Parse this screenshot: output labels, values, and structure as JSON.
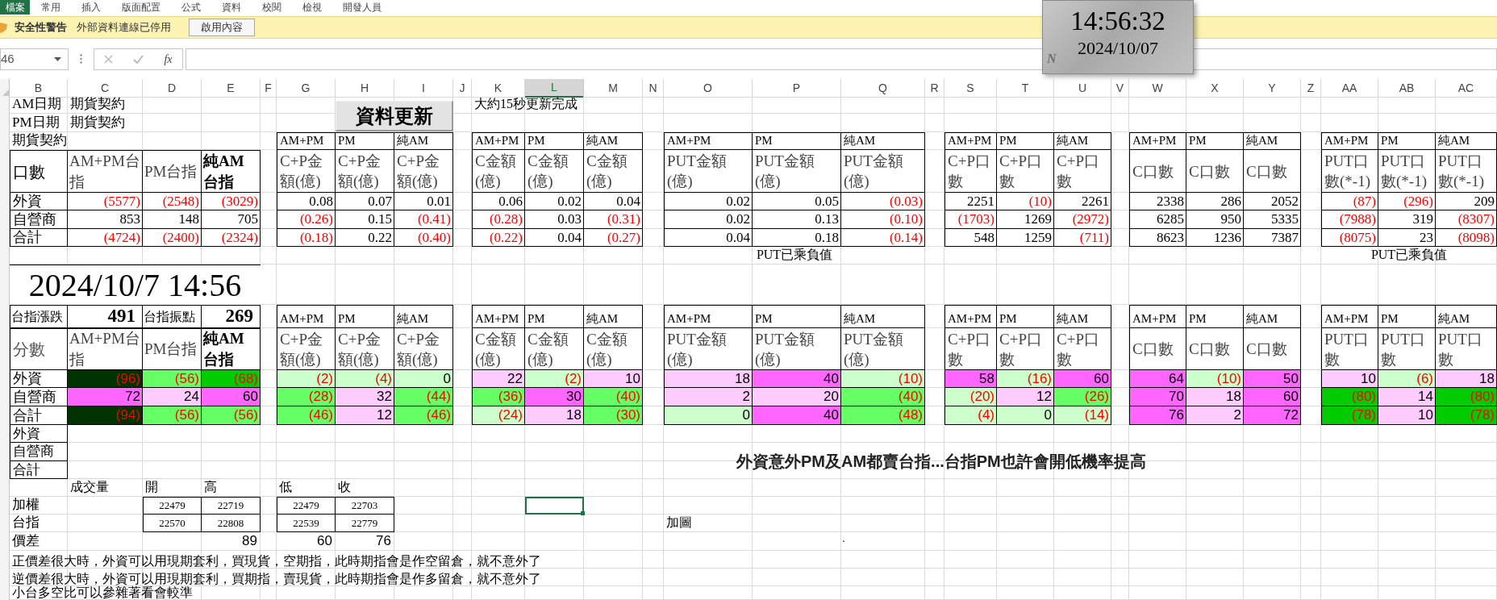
{
  "ribbon": {
    "file_tab": "檔案",
    "tabs": [
      "常用",
      "插入",
      "版面配置",
      "公式",
      "資料",
      "校閱",
      "檢視",
      "開發人員"
    ]
  },
  "security_bar": {
    "title": "安全性警告",
    "message": "外部資料連線已停用",
    "button": "啟用內容"
  },
  "formula_bar": {
    "name_box": "46",
    "function_button": "fx"
  },
  "clock": {
    "time": "14:56:32",
    "date": "2024/10/07",
    "badge": "N"
  },
  "columns": [
    {
      "label": "B",
      "selected": false
    },
    {
      "label": "C",
      "selected": false
    },
    {
      "label": "D",
      "selected": false
    },
    {
      "label": "E",
      "selected": false
    },
    {
      "label": "F",
      "selected": false
    },
    {
      "label": "G",
      "selected": false
    },
    {
      "label": "H",
      "selected": false
    },
    {
      "label": "I",
      "selected": false
    },
    {
      "label": "J",
      "selected": false
    },
    {
      "label": "K",
      "selected": false
    },
    {
      "label": "L",
      "selected": true
    },
    {
      "label": "M",
      "selected": false
    },
    {
      "label": "N",
      "selected": false
    },
    {
      "label": "O",
      "selected": false
    },
    {
      "label": "P",
      "selected": false
    },
    {
      "label": "Q",
      "selected": false
    },
    {
      "label": "R",
      "selected": false
    },
    {
      "label": "S",
      "selected": false
    },
    {
      "label": "T",
      "selected": false
    },
    {
      "label": "U",
      "selected": false
    },
    {
      "label": "V",
      "selected": false
    },
    {
      "label": "W",
      "selected": false
    },
    {
      "label": "X",
      "selected": false
    },
    {
      "label": "Y",
      "selected": false
    },
    {
      "label": "Z",
      "selected": false
    },
    {
      "label": "AA",
      "selected": false
    },
    {
      "label": "AB",
      "selected": false
    },
    {
      "label": "AC",
      "selected": false
    }
  ],
  "sheet": {
    "info_rows": [
      [
        "AM日期",
        "期貨契約"
      ],
      [
        "PM日期",
        "期貨契約"
      ]
    ],
    "refresh_button": "資料更新",
    "refresh_note": "大約15秒更新完成",
    "upper": {
      "caption": "期貨契約",
      "summary": {
        "corner": "口數",
        "headers": [
          {
            "text": "AM+PM台指",
            "bold": false
          },
          {
            "text": "PM台指",
            "bold": false
          },
          {
            "text": "純AM台指",
            "bold": true
          }
        ],
        "rows": [
          {
            "label": "外資",
            "cells": [
              {
                "value": "(5577)",
                "negative": true
              },
              {
                "value": "(2548)",
                "negative": true
              },
              {
                "value": "(3029)",
                "negative": true
              }
            ]
          },
          {
            "label": "自營商",
            "cells": [
              {
                "value": "853",
                "negative": false
              },
              {
                "value": "148",
                "negative": false
              },
              {
                "value": "705",
                "negative": false
              }
            ]
          },
          {
            "label": "合計",
            "cells": [
              {
                "value": "(4724)",
                "negative": true
              },
              {
                "value": "(2400)",
                "negative": true
              },
              {
                "value": "(2324)",
                "negative": true
              }
            ]
          }
        ]
      },
      "groups": [
        {
          "periods": [
            "AM+PM",
            "PM",
            "純AM"
          ],
          "headers": [
            "C+P金額(億)",
            "C+P金額(億)",
            "C+P金額(億)"
          ],
          "rows": [
            [
              {
                "value": "0.08",
                "negative": false
              },
              {
                "value": "0.07",
                "negative": false
              },
              {
                "value": "0.01",
                "negative": false
              }
            ],
            [
              {
                "value": "(0.26)",
                "negative": true
              },
              {
                "value": "0.15",
                "negative": false
              },
              {
                "value": "(0.41)",
                "negative": true
              }
            ],
            [
              {
                "value": "(0.18)",
                "negative": true
              },
              {
                "value": "0.22",
                "negative": false
              },
              {
                "value": "(0.40)",
                "negative": true
              }
            ]
          ]
        },
        {
          "periods": [
            "AM+PM",
            "PM",
            "純AM"
          ],
          "headers": [
            "C金額(億)",
            "C金額(億)",
            "C金額(億)"
          ],
          "rows": [
            [
              {
                "value": "0.06",
                "negative": false
              },
              {
                "value": "0.02",
                "negative": false
              },
              {
                "value": "0.04",
                "negative": false
              }
            ],
            [
              {
                "value": "(0.28)",
                "negative": true
              },
              {
                "value": "0.03",
                "negative": false
              },
              {
                "value": "(0.31)",
                "negative": true
              }
            ],
            [
              {
                "value": "(0.22)",
                "negative": true
              },
              {
                "value": "0.04",
                "negative": false
              },
              {
                "value": "(0.27)",
                "negative": true
              }
            ]
          ]
        },
        {
          "periods": [
            "AM+PM",
            "PM",
            "純AM"
          ],
          "headers": [
            "PUT金額(億)",
            "PUT金額(億)",
            "PUT金額(億)"
          ],
          "rows": [
            [
              {
                "value": "0.02",
                "negative": false
              },
              {
                "value": "0.05",
                "negative": false
              },
              {
                "value": "(0.03)",
                "negative": true
              }
            ],
            [
              {
                "value": "0.02",
                "negative": false
              },
              {
                "value": "0.13",
                "negative": false
              },
              {
                "value": "(0.10)",
                "negative": true
              }
            ],
            [
              {
                "value": "0.04",
                "negative": false
              },
              {
                "value": "0.18",
                "negative": false
              },
              {
                "value": "(0.14)",
                "negative": true
              }
            ]
          ],
          "note": "PUT已乘負值"
        },
        {
          "periods": [
            "AM+PM",
            "PM",
            "純AM"
          ],
          "headers": [
            "C+P口數",
            "C+P口數",
            "C+P口數"
          ],
          "rows": [
            [
              {
                "value": "2251",
                "negative": false
              },
              {
                "value": "(10)",
                "negative": true
              },
              {
                "value": "2261",
                "negative": false
              }
            ],
            [
              {
                "value": "(1703)",
                "negative": true
              },
              {
                "value": "1269",
                "negative": false
              },
              {
                "value": "(2972)",
                "negative": true
              }
            ],
            [
              {
                "value": "548",
                "negative": false
              },
              {
                "value": "1259",
                "negative": false
              },
              {
                "value": "(711)",
                "negative": true
              }
            ]
          ]
        },
        {
          "periods": [
            "AM+PM",
            "PM",
            "純AM"
          ],
          "headers": [
            "C口數",
            "C口數",
            "C口數"
          ],
          "rows": [
            [
              {
                "value": "2338",
                "negative": false
              },
              {
                "value": "286",
                "negative": false
              },
              {
                "value": "2052",
                "negative": false
              }
            ],
            [
              {
                "value": "6285",
                "negative": false
              },
              {
                "value": "950",
                "negative": false
              },
              {
                "value": "5335",
                "negative": false
              }
            ],
            [
              {
                "value": "8623",
                "negative": false
              },
              {
                "value": "1236",
                "negative": false
              },
              {
                "value": "7387",
                "negative": false
              }
            ]
          ]
        },
        {
          "periods": [
            "AM+PM",
            "PM",
            "純AM"
          ],
          "headers": [
            "PUT口數(*-1)",
            "PUT口數(*-1)",
            "PUT口數(*-1)"
          ],
          "rows": [
            [
              {
                "value": "(87)",
                "negative": true
              },
              {
                "value": "(296)",
                "negative": true
              },
              {
                "value": "209",
                "negative": false
              }
            ],
            [
              {
                "value": "(7988)",
                "negative": true
              },
              {
                "value": "319",
                "negative": false
              },
              {
                "value": "(8307)",
                "negative": true
              }
            ],
            [
              {
                "value": "(8075)",
                "negative": true
              },
              {
                "value": "23",
                "negative": false
              },
              {
                "value": "(8098)",
                "negative": true
              }
            ]
          ],
          "note": "PUT已乘負值"
        }
      ]
    },
    "timestamp": "2024/10/7 14:56",
    "lower": {
      "stats": [
        {
          "label": "台指漲跌",
          "value": "491"
        },
        {
          "label": "台指振點",
          "value": "269"
        }
      ],
      "summary": {
        "corner": "分數",
        "headers": [
          {
            "text": "AM+PM台指",
            "bold": false
          },
          {
            "text": "PM台指",
            "bold": false
          },
          {
            "text": "純AM台指",
            "bold": true
          }
        ],
        "rows": [
          {
            "label": "外資",
            "cells": [
              {
                "value": "(96)",
                "negative": true,
                "color": "#003300"
              },
              {
                "value": "(56)",
                "negative": true,
                "color": "#66ff66"
              },
              {
                "value": "(68)",
                "negative": true,
                "color": "#00cc00"
              }
            ]
          },
          {
            "label": "自營商",
            "cells": [
              {
                "value": "72",
                "negative": false,
                "color": "#ff66ff"
              },
              {
                "value": "24",
                "negative": false,
                "color": "#ffccff"
              },
              {
                "value": "60",
                "negative": false,
                "color": "#ff66ff"
              }
            ]
          },
          {
            "label": "合計",
            "cells": [
              {
                "value": "(94)",
                "negative": true,
                "color": "#003300"
              },
              {
                "value": "(56)",
                "negative": true,
                "color": "#66ff66"
              },
              {
                "value": "(56)",
                "negative": true,
                "color": "#66ff66"
              }
            ]
          }
        ]
      },
      "groups": [
        {
          "periods": [
            "AM+PM",
            "PM",
            "純AM"
          ],
          "headers": [
            "C+P金額(億)",
            "C+P金額(億)",
            "C+P金額(億)"
          ],
          "rows": [
            [
              {
                "value": "(2)",
                "negative": true,
                "color": "#ccffcc"
              },
              {
                "value": "(4)",
                "negative": true,
                "color": "#ccffcc"
              },
              {
                "value": "0",
                "negative": false,
                "color": "#ccffcc"
              }
            ],
            [
              {
                "value": "(28)",
                "negative": true,
                "color": "#66ff66"
              },
              {
                "value": "32",
                "negative": false,
                "color": "#ffccff"
              },
              {
                "value": "(44)",
                "negative": true,
                "color": "#66ff66"
              }
            ],
            [
              {
                "value": "(46)",
                "negative": true,
                "color": "#66ff66"
              },
              {
                "value": "12",
                "negative": false,
                "color": "#ffccff"
              },
              {
                "value": "(46)",
                "negative": true,
                "color": "#66ff66"
              }
            ]
          ]
        },
        {
          "periods": [
            "AM+PM",
            "PM",
            "純AM"
          ],
          "headers": [
            "C金額(億)",
            "C金額(億)",
            "C金額(億)"
          ],
          "rows": [
            [
              {
                "value": "22",
                "negative": false,
                "color": "#ffccff"
              },
              {
                "value": "(2)",
                "negative": true,
                "color": "#ccffcc"
              },
              {
                "value": "10",
                "negative": false,
                "color": "#ffccff"
              }
            ],
            [
              {
                "value": "(36)",
                "negative": true,
                "color": "#66ff66"
              },
              {
                "value": "30",
                "negative": false,
                "color": "#ff66ff"
              },
              {
                "value": "(40)",
                "negative": true,
                "color": "#66ff66"
              }
            ],
            [
              {
                "value": "(24)",
                "negative": true,
                "color": "#ccffcc"
              },
              {
                "value": "18",
                "negative": false,
                "color": "#ffccff"
              },
              {
                "value": "(30)",
                "negative": true,
                "color": "#66ff66"
              }
            ]
          ]
        },
        {
          "periods": [
            "AM+PM",
            "PM",
            "純AM"
          ],
          "headers": [
            "PUT金額(億)",
            "PUT金額(億)",
            "PUT金額(億)"
          ],
          "rows": [
            [
              {
                "value": "18",
                "negative": false,
                "color": "#ffccff"
              },
              {
                "value": "40",
                "negative": false,
                "color": "#ff66ff"
              },
              {
                "value": "(10)",
                "negative": true,
                "color": "#ccffcc"
              }
            ],
            [
              {
                "value": "2",
                "negative": false,
                "color": "#ffccff"
              },
              {
                "value": "20",
                "negative": false,
                "color": "#ffccff"
              },
              {
                "value": "(40)",
                "negative": true,
                "color": "#66ff66"
              }
            ],
            [
              {
                "value": "0",
                "negative": false,
                "color": "#ccffcc"
              },
              {
                "value": "40",
                "negative": false,
                "color": "#ff66ff"
              },
              {
                "value": "(48)",
                "negative": true,
                "color": "#66ff66"
              }
            ]
          ]
        },
        {
          "periods": [
            "AM+PM",
            "PM",
            "純AM"
          ],
          "headers": [
            "C+P口數",
            "C+P口數",
            "C+P口數"
          ],
          "rows": [
            [
              {
                "value": "58",
                "negative": false,
                "color": "#ff66ff"
              },
              {
                "value": "(16)",
                "negative": true,
                "color": "#ccffcc"
              },
              {
                "value": "60",
                "negative": false,
                "color": "#ff66ff"
              }
            ],
            [
              {
                "value": "(20)",
                "negative": true,
                "color": "#ccffcc"
              },
              {
                "value": "12",
                "negative": false,
                "color": "#ffccff"
              },
              {
                "value": "(26)",
                "negative": true,
                "color": "#66ff66"
              }
            ],
            [
              {
                "value": "(4)",
                "negative": true,
                "color": "#ccffcc"
              },
              {
                "value": "0",
                "negative": false,
                "color": "#ccffcc"
              },
              {
                "value": "(14)",
                "negative": true,
                "color": "#ccffcc"
              }
            ]
          ]
        },
        {
          "periods": [
            "AM+PM",
            "PM",
            "純AM"
          ],
          "headers": [
            "C口數",
            "C口數",
            "C口數"
          ],
          "rows": [
            [
              {
                "value": "64",
                "negative": false,
                "color": "#ff66ff"
              },
              {
                "value": "(10)",
                "negative": true,
                "color": "#ccffcc"
              },
              {
                "value": "50",
                "negative": false,
                "color": "#ff66ff"
              }
            ],
            [
              {
                "value": "70",
                "negative": false,
                "color": "#ff66ff"
              },
              {
                "value": "18",
                "negative": false,
                "color": "#ffccff"
              },
              {
                "value": "60",
                "negative": false,
                "color": "#ff66ff"
              }
            ],
            [
              {
                "value": "76",
                "negative": false,
                "color": "#ff66ff"
              },
              {
                "value": "2",
                "negative": false,
                "color": "#ffccff"
              },
              {
                "value": "72",
                "negative": false,
                "color": "#ff66ff"
              }
            ]
          ]
        },
        {
          "periods": [
            "AM+PM",
            "PM",
            "純AM"
          ],
          "headers": [
            "PUT口數",
            "PUT口數",
            "PUT口數"
          ],
          "rows": [
            [
              {
                "value": "10",
                "negative": false,
                "color": "#ffccff"
              },
              {
                "value": "(6)",
                "negative": true,
                "color": "#ccffcc"
              },
              {
                "value": "18",
                "negative": false,
                "color": "#ffccff"
              }
            ],
            [
              {
                "value": "(80)",
                "negative": true,
                "color": "#00cc00"
              },
              {
                "value": "14",
                "negative": false,
                "color": "#ffccff"
              },
              {
                "value": "(80)",
                "negative": true,
                "color": "#00cc00"
              }
            ],
            [
              {
                "value": "(78)",
                "negative": true,
                "color": "#00cc00"
              },
              {
                "value": "10",
                "negative": false,
                "color": "#ffccff"
              },
              {
                "value": "(78)",
                "negative": true,
                "color": "#00cc00"
              }
            ]
          ]
        }
      ],
      "extra_labels": [
        "外資",
        "自營商",
        "合計"
      ]
    },
    "message": "外資意外PM及AM都賣台指...台指PM也許會開低機率提高",
    "price_table": {
      "headers": [
        "成交量",
        "開",
        "高",
        "低",
        "收"
      ],
      "rows": [
        {
          "label": "加權",
          "values": [
            "22479",
            "22719",
            "22479",
            "22703"
          ]
        },
        {
          "label": "台指",
          "values": [
            "22570",
            "22808",
            "22539",
            "22779"
          ]
        }
      ],
      "spread": {
        "label": "價差",
        "values": [
          "89",
          "60",
          "76"
        ]
      }
    },
    "chart_note": "加圖",
    "dot": ".",
    "notes": [
      "正價差很大時，外資可以用現期套利，買現貨，空期指，此時期指會是作空留倉，就不意外了",
      "逆價差很大時，外資可以用現期套利，買期指，賣現貨，此時期指會是作多留倉，就不意外了",
      "小台多空比可以參雜著看會較準"
    ]
  }
}
